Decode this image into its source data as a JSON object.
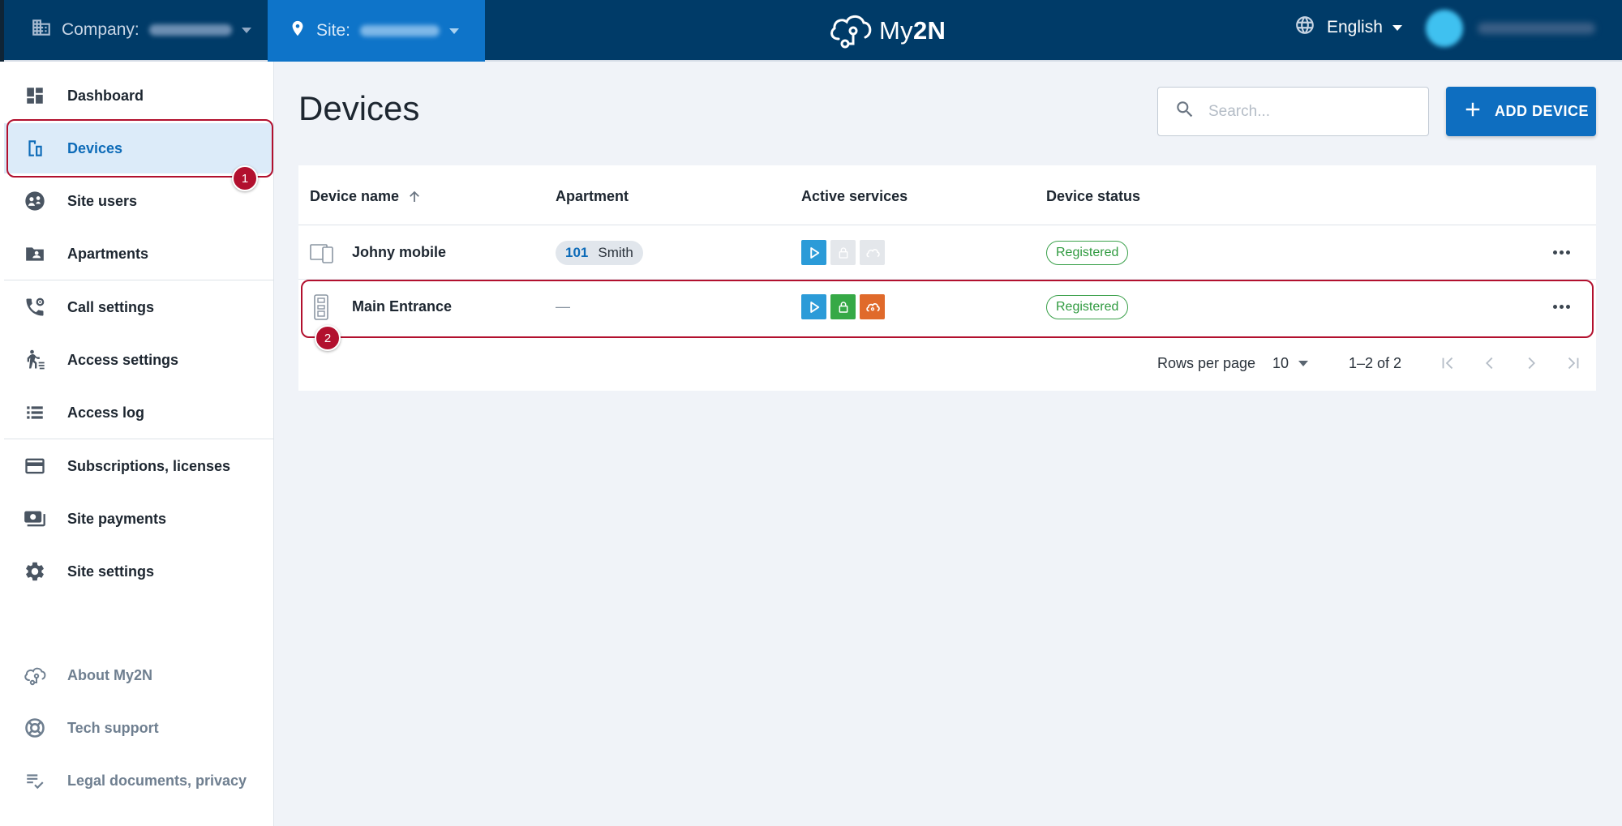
{
  "topbar": {
    "company_label": "Company:",
    "site_label": "Site:",
    "logo_text_prefix": "My",
    "logo_text_bold": "2N",
    "language": "English"
  },
  "sidebar": {
    "items": [
      {
        "label": "Dashboard",
        "icon": "dashboard-icon"
      },
      {
        "label": "Devices",
        "icon": "devices-icon"
      },
      {
        "label": "Site users",
        "icon": "users-icon"
      },
      {
        "label": "Apartments",
        "icon": "apartments-icon"
      },
      {
        "label": "Call settings",
        "icon": "call-settings-icon"
      },
      {
        "label": "Access settings",
        "icon": "access-settings-icon"
      },
      {
        "label": "Access log",
        "icon": "access-log-icon"
      },
      {
        "label": "Subscriptions, licenses",
        "icon": "subscriptions-icon"
      },
      {
        "label": "Site payments",
        "icon": "payments-icon"
      },
      {
        "label": "Site settings",
        "icon": "gear-icon"
      }
    ],
    "footer_items": [
      {
        "label": "About My2N",
        "icon": "cloud-icon"
      },
      {
        "label": "Tech support",
        "icon": "lifebuoy-icon"
      },
      {
        "label": "Legal documents, privacy",
        "icon": "document-check-icon"
      }
    ]
  },
  "main": {
    "title": "Devices",
    "search_placeholder": "Search...",
    "add_device_label": "ADD DEVICE"
  },
  "table": {
    "columns": [
      "Device name",
      "Apartment",
      "Active services",
      "Device status"
    ],
    "rows": [
      {
        "device_name": "Johny mobile",
        "apartment_number": "101",
        "apartment_name": "Smith",
        "services": {
          "mobile_video": "active",
          "local_calls": "inactive",
          "remote_config": "inactive"
        },
        "status": "Registered"
      },
      {
        "device_name": "Main Entrance",
        "apartment_dash": "—",
        "services": {
          "mobile_video": "active",
          "local_calls": "active",
          "remote_config": "active"
        },
        "status": "Registered"
      }
    ]
  },
  "pagination": {
    "rows_per_page_label": "Rows per page",
    "rows_per_page_value": "10",
    "range": "1–2 of 2"
  },
  "callouts": {
    "first": "1",
    "second": "2"
  },
  "colors": {
    "topbar": "#003b68",
    "site_tab": "#0e74c9",
    "accent": "#0e6ec0",
    "callout": "#b2102e",
    "status_green": "#2f9a3f",
    "service_blue": "#2b9bd8",
    "service_green": "#36a946",
    "service_orange": "#e06a2b"
  }
}
